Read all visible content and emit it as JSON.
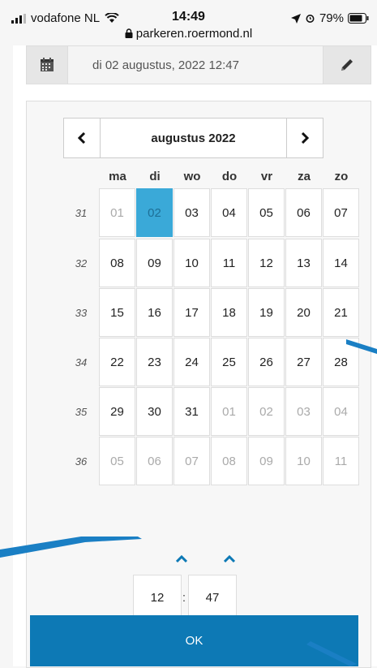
{
  "status_bar": {
    "carrier": "vodafone NL",
    "time": "14:49",
    "battery": "79%",
    "url": "parkeren.roermond.nl",
    "icons": [
      "signal-icon",
      "wifi-icon",
      "lock-icon",
      "location-arrow-icon",
      "alarm-icon",
      "battery-icon"
    ]
  },
  "date_field": {
    "value": "di 02 augustus, 2022 12:47",
    "icons": [
      "calendar-icon",
      "pencil-icon"
    ]
  },
  "calendar": {
    "month_label": "augustus 2022",
    "prev_label": "‹",
    "next_label": "›",
    "weekdays": [
      "ma",
      "di",
      "wo",
      "do",
      "vr",
      "za",
      "zo"
    ],
    "weeks": [
      {
        "no": "31",
        "days": [
          [
            "01",
            true
          ],
          [
            "02",
            false
          ],
          [
            "03",
            false
          ],
          [
            "04",
            false
          ],
          [
            "05",
            false
          ],
          [
            "06",
            false
          ],
          [
            "07",
            false
          ]
        ]
      },
      {
        "no": "32",
        "days": [
          [
            "08",
            false
          ],
          [
            "09",
            false
          ],
          [
            "10",
            false
          ],
          [
            "11",
            false
          ],
          [
            "12",
            false
          ],
          [
            "13",
            false
          ],
          [
            "14",
            false
          ]
        ]
      },
      {
        "no": "33",
        "days": [
          [
            "15",
            false
          ],
          [
            "16",
            false
          ],
          [
            "17",
            false
          ],
          [
            "18",
            false
          ],
          [
            "19",
            false
          ],
          [
            "20",
            false
          ],
          [
            "21",
            false
          ]
        ]
      },
      {
        "no": "34",
        "days": [
          [
            "22",
            false
          ],
          [
            "23",
            false
          ],
          [
            "24",
            false
          ],
          [
            "25",
            false
          ],
          [
            "26",
            false
          ],
          [
            "27",
            false
          ],
          [
            "28",
            false
          ]
        ]
      },
      {
        "no": "35",
        "days": [
          [
            "29",
            false
          ],
          [
            "30",
            false
          ],
          [
            "31",
            false
          ],
          [
            "01",
            true
          ],
          [
            "02",
            true
          ],
          [
            "03",
            true
          ],
          [
            "04",
            true
          ]
        ]
      },
      {
        "no": "36",
        "days": [
          [
            "05",
            true
          ],
          [
            "06",
            true
          ],
          [
            "07",
            true
          ],
          [
            "08",
            true
          ],
          [
            "09",
            true
          ],
          [
            "10",
            true
          ],
          [
            "11",
            true
          ]
        ]
      }
    ],
    "selected_day": "02",
    "selected_color": "#3aa9d8"
  },
  "time": {
    "hour": "12",
    "minute": "47",
    "separator": ":"
  },
  "ok_label": "OK",
  "colors": {
    "accent": "#0d79b5",
    "selected": "#3aa9d8",
    "callout": "#1a7fc4"
  }
}
